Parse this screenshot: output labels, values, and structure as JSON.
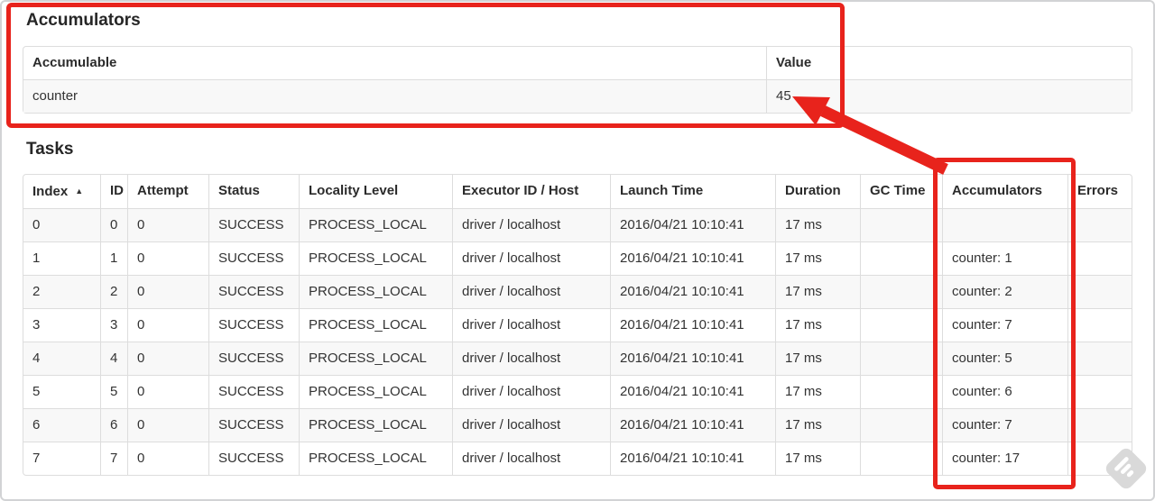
{
  "annotations": {
    "color": "#e8231c",
    "highlight_targets": [
      "accumulators-section",
      "accumulators-column",
      "value-45"
    ]
  },
  "accumulators_section": {
    "title": "Accumulators",
    "table": {
      "headers": [
        "Accumulable",
        "Value"
      ],
      "rows": [
        {
          "accumulable": "counter",
          "value": "45"
        }
      ]
    }
  },
  "tasks_section": {
    "title": "Tasks",
    "table": {
      "sort_indicator": "▲",
      "columns": [
        {
          "key": "index",
          "label": "Index",
          "sorted": true
        },
        {
          "key": "id",
          "label": "ID"
        },
        {
          "key": "attempt",
          "label": "Attempt"
        },
        {
          "key": "status",
          "label": "Status"
        },
        {
          "key": "locality_level",
          "label": "Locality Level"
        },
        {
          "key": "executor_id_host",
          "label": "Executor ID / Host"
        },
        {
          "key": "launch_time",
          "label": "Launch Time"
        },
        {
          "key": "duration",
          "label": "Duration"
        },
        {
          "key": "gc_time",
          "label": "GC Time"
        },
        {
          "key": "accumulators",
          "label": "Accumulators"
        },
        {
          "key": "errors",
          "label": "Errors"
        }
      ],
      "rows": [
        {
          "index": "0",
          "id": "0",
          "attempt": "0",
          "status": "SUCCESS",
          "locality_level": "PROCESS_LOCAL",
          "executor_id_host": "driver / localhost",
          "launch_time": "2016/04/21 10:10:41",
          "duration": "17 ms",
          "gc_time": "",
          "accumulators": "",
          "errors": ""
        },
        {
          "index": "1",
          "id": "1",
          "attempt": "0",
          "status": "SUCCESS",
          "locality_level": "PROCESS_LOCAL",
          "executor_id_host": "driver / localhost",
          "launch_time": "2016/04/21 10:10:41",
          "duration": "17 ms",
          "gc_time": "",
          "accumulators": "counter: 1",
          "errors": ""
        },
        {
          "index": "2",
          "id": "2",
          "attempt": "0",
          "status": "SUCCESS",
          "locality_level": "PROCESS_LOCAL",
          "executor_id_host": "driver / localhost",
          "launch_time": "2016/04/21 10:10:41",
          "duration": "17 ms",
          "gc_time": "",
          "accumulators": "counter: 2",
          "errors": ""
        },
        {
          "index": "3",
          "id": "3",
          "attempt": "0",
          "status": "SUCCESS",
          "locality_level": "PROCESS_LOCAL",
          "executor_id_host": "driver / localhost",
          "launch_time": "2016/04/21 10:10:41",
          "duration": "17 ms",
          "gc_time": "",
          "accumulators": "counter: 7",
          "errors": ""
        },
        {
          "index": "4",
          "id": "4",
          "attempt": "0",
          "status": "SUCCESS",
          "locality_level": "PROCESS_LOCAL",
          "executor_id_host": "driver / localhost",
          "launch_time": "2016/04/21 10:10:41",
          "duration": "17 ms",
          "gc_time": "",
          "accumulators": "counter: 5",
          "errors": ""
        },
        {
          "index": "5",
          "id": "5",
          "attempt": "0",
          "status": "SUCCESS",
          "locality_level": "PROCESS_LOCAL",
          "executor_id_host": "driver / localhost",
          "launch_time": "2016/04/21 10:10:41",
          "duration": "17 ms",
          "gc_time": "",
          "accumulators": "counter: 6",
          "errors": ""
        },
        {
          "index": "6",
          "id": "6",
          "attempt": "0",
          "status": "SUCCESS",
          "locality_level": "PROCESS_LOCAL",
          "executor_id_host": "driver / localhost",
          "launch_time": "2016/04/21 10:10:41",
          "duration": "17 ms",
          "gc_time": "",
          "accumulators": "counter: 7",
          "errors": ""
        },
        {
          "index": "7",
          "id": "7",
          "attempt": "0",
          "status": "SUCCESS",
          "locality_level": "PROCESS_LOCAL",
          "executor_id_host": "driver / localhost",
          "launch_time": "2016/04/21 10:10:41",
          "duration": "17 ms",
          "gc_time": "",
          "accumulators": "counter: 17",
          "errors": ""
        }
      ]
    }
  },
  "icons": {
    "sort_ascending": "up-triangle",
    "watermark": "gray-diamond-feather"
  }
}
